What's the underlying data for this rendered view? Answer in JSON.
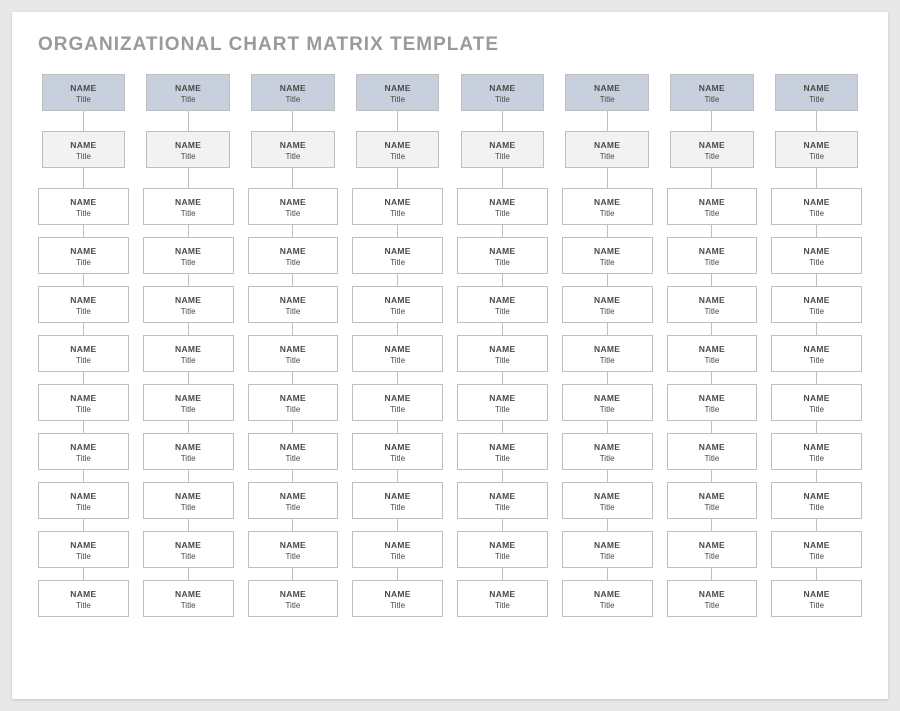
{
  "header": {
    "title": "ORGANIZATIONAL CHART MATRIX TEMPLATE"
  },
  "cell": {
    "name_label": "NAME",
    "title_label": "Title"
  },
  "grid": {
    "columns": 8,
    "rows": 11
  }
}
